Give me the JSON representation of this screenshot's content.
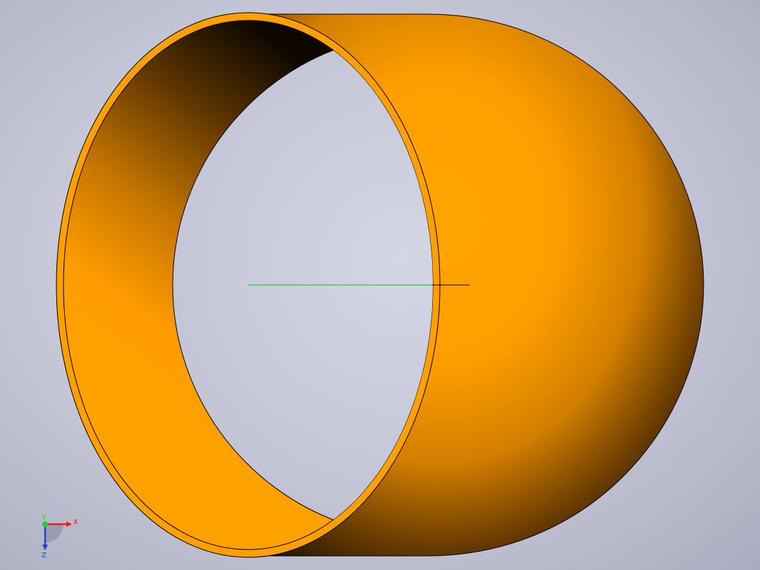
{
  "viewport": {
    "background_color": "#c9cbdb",
    "part_color": "#ffa000",
    "part_shadow_color": "#0a0600",
    "edge_color": "#000000",
    "axis_line_color": "#00cc00"
  },
  "triad": {
    "x_label": "X",
    "y_label": "Y",
    "z_label": "Z",
    "x_color": "#e8201c",
    "y_color": "#1fcf2a",
    "z_color": "#2040d8"
  }
}
